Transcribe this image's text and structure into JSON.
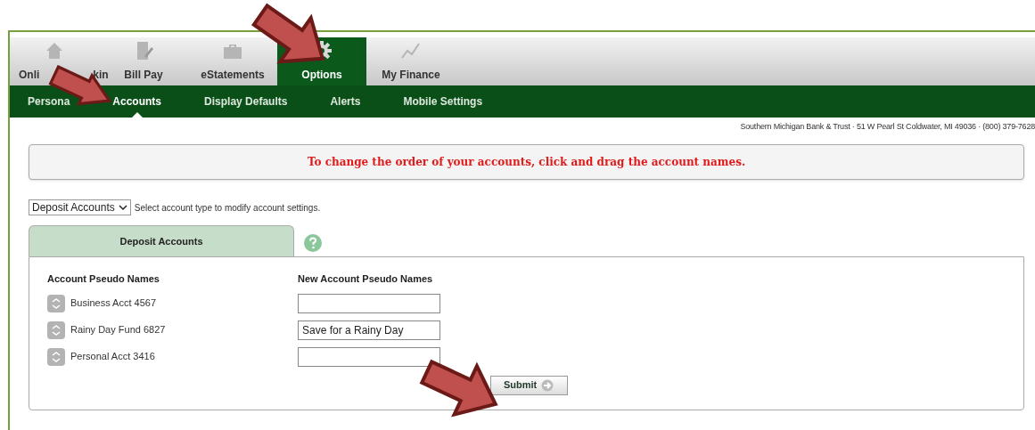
{
  "main_tabs": [
    {
      "label": "Onli",
      "label_end": "kin",
      "selected": false
    },
    {
      "label": "Bill Pay",
      "selected": false
    },
    {
      "label": "eStatements",
      "selected": false
    },
    {
      "label": "Options",
      "selected": true
    },
    {
      "label": "My Finance",
      "selected": false
    }
  ],
  "sub_tabs": [
    {
      "label": "Persona",
      "selected": false
    },
    {
      "label": "Accounts",
      "selected": true
    },
    {
      "label": "Display Defaults",
      "selected": false
    },
    {
      "label": "Alerts",
      "selected": false
    },
    {
      "label": "Mobile Settings",
      "selected": false
    }
  ],
  "bank_info": "Southern Michigan Bank & Trust · 51 W Pearl St Coldwater, MI 49036 · (800) 379-7628",
  "notice": "To change the order of your accounts, click and drag the account names.",
  "account_type": {
    "value": "Deposit Accounts",
    "hint": "Select account type to modify account settings."
  },
  "panel": {
    "tab": "Deposit Accounts",
    "columns": [
      "Account Pseudo Names",
      "New Account Pseudo Names"
    ],
    "rows": [
      {
        "name": "Business Acct 4567",
        "new_name": ""
      },
      {
        "name": "Rainy Day Fund 6827",
        "new_name": "Save for a Rainy Day"
      },
      {
        "name": "Personal Acct 3416",
        "new_name": ""
      }
    ],
    "submit": "Submit"
  }
}
